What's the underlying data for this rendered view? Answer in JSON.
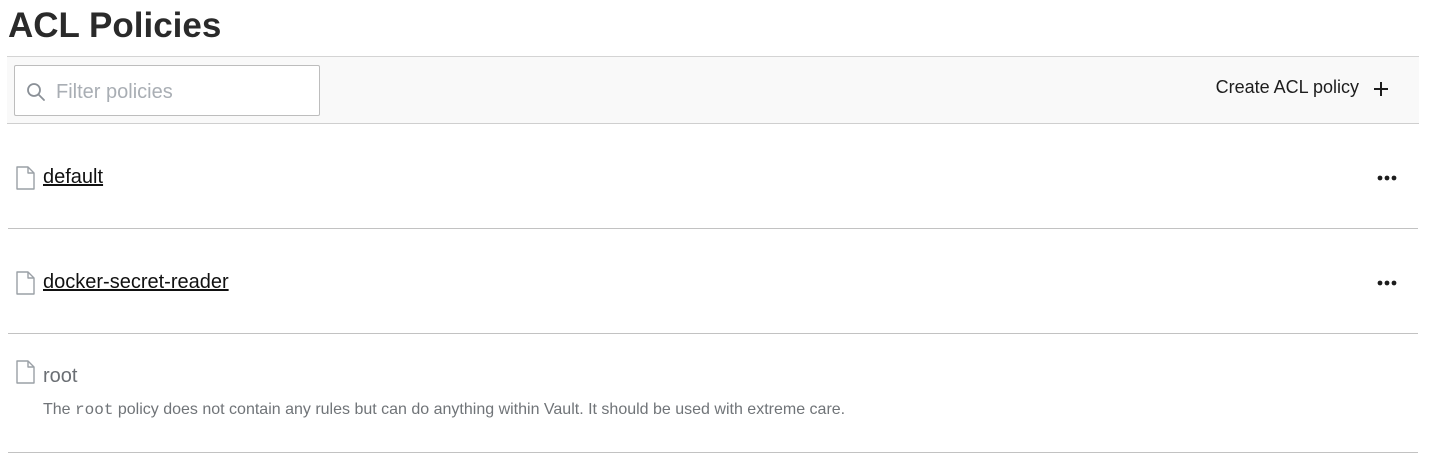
{
  "page": {
    "title": "ACL Policies"
  },
  "toolbar": {
    "search": {
      "placeholder": "Filter policies",
      "value": "",
      "icon": "search-icon"
    },
    "create_label": "Create ACL policy",
    "create_icon": "plus-icon"
  },
  "policies": [
    {
      "name": "default",
      "link": true,
      "menu_icon": "more-icon"
    },
    {
      "name": "docker-secret-reader",
      "link": true,
      "menu_icon": "more-icon"
    },
    {
      "name": "root",
      "link": false,
      "description_before": "The ",
      "description_code": "root",
      "description_after": " policy does not contain any rules but can do anything within Vault. It should be used with extreme care."
    }
  ],
  "colors": {
    "toolbar_bg": "#f9f9f9",
    "border": "#c2c2c2",
    "muted_text": "#707478",
    "text": "#1d1d1d"
  }
}
